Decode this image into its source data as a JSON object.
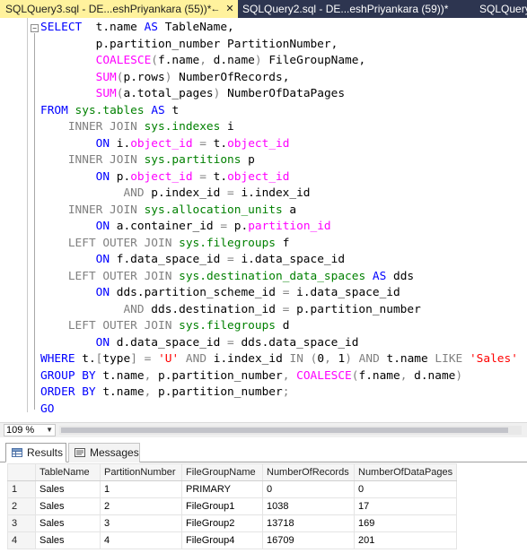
{
  "tabs": [
    {
      "label": "SQLQuery3.sql - DE...eshPriyankara (55))*",
      "pin": "←",
      "close": "✕",
      "active": true
    },
    {
      "label": "SQLQuery2.sql - DE...eshPriyankara (59))*"
    },
    {
      "label": "SQLQuery"
    }
  ],
  "editor": {
    "outline_toggle": "−",
    "lines": [
      [
        [
          "kw",
          "SELECT"
        ],
        [
          "",
          "  t.name "
        ],
        [
          "kw",
          "AS"
        ],
        [
          "",
          " TableName,"
        ]
      ],
      [
        [
          "",
          "        p.partition_number PartitionNumber,"
        ]
      ],
      [
        [
          "",
          "        "
        ],
        [
          "fn",
          "COALESCE"
        ],
        [
          "op",
          "("
        ],
        [
          "",
          "f.name"
        ],
        [
          "op",
          ","
        ],
        [
          "",
          " d.name"
        ],
        [
          "op",
          ")"
        ],
        [
          "",
          " FileGroupName,"
        ]
      ],
      [
        [
          "",
          "        "
        ],
        [
          "fn",
          "SUM"
        ],
        [
          "op",
          "("
        ],
        [
          "",
          "p.rows"
        ],
        [
          "op",
          ")"
        ],
        [
          "",
          " NumberOfRecords,"
        ]
      ],
      [
        [
          "",
          "        "
        ],
        [
          "fn",
          "SUM"
        ],
        [
          "op",
          "("
        ],
        [
          "",
          "a.total_pages"
        ],
        [
          "op",
          ")"
        ],
        [
          "",
          " NumberOfDataPages"
        ]
      ],
      [
        [
          "kw",
          "FROM"
        ],
        [
          "",
          " "
        ],
        [
          "sys",
          "sys.tables"
        ],
        [
          "",
          " "
        ],
        [
          "kw",
          "AS"
        ],
        [
          "",
          " t"
        ]
      ],
      [
        [
          "",
          "    "
        ],
        [
          "op",
          "INNER JOIN"
        ],
        [
          "",
          " "
        ],
        [
          "sys",
          "sys.indexes"
        ],
        [
          "",
          " i"
        ]
      ],
      [
        [
          "",
          "        "
        ],
        [
          "kw",
          "ON"
        ],
        [
          "",
          " i."
        ],
        [
          "fn",
          "object_id"
        ],
        [
          "",
          " "
        ],
        [
          "op",
          "="
        ],
        [
          "",
          " t."
        ],
        [
          "fn",
          "object_id"
        ]
      ],
      [
        [
          "",
          "    "
        ],
        [
          "op",
          "INNER JOIN"
        ],
        [
          "",
          " "
        ],
        [
          "sys",
          "sys.partitions"
        ],
        [
          "",
          " p"
        ]
      ],
      [
        [
          "",
          "        "
        ],
        [
          "kw",
          "ON"
        ],
        [
          "",
          " p."
        ],
        [
          "fn",
          "object_id"
        ],
        [
          "",
          " "
        ],
        [
          "op",
          "="
        ],
        [
          "",
          " t."
        ],
        [
          "fn",
          "object_id"
        ]
      ],
      [
        [
          "",
          "            "
        ],
        [
          "op",
          "AND"
        ],
        [
          "",
          " p.index_id "
        ],
        [
          "op",
          "="
        ],
        [
          "",
          " i.index_id"
        ]
      ],
      [
        [
          "",
          "    "
        ],
        [
          "op",
          "INNER JOIN"
        ],
        [
          "",
          " "
        ],
        [
          "sys",
          "sys.allocation_units"
        ],
        [
          "",
          " a"
        ]
      ],
      [
        [
          "",
          "        "
        ],
        [
          "kw",
          "ON"
        ],
        [
          "",
          " a.container_id "
        ],
        [
          "op",
          "="
        ],
        [
          "",
          " p."
        ],
        [
          "fn",
          "partition_id"
        ]
      ],
      [
        [
          "",
          "    "
        ],
        [
          "op",
          "LEFT OUTER JOIN"
        ],
        [
          "",
          " "
        ],
        [
          "sys",
          "sys.filegroups"
        ],
        [
          "",
          " f"
        ]
      ],
      [
        [
          "",
          "        "
        ],
        [
          "kw",
          "ON"
        ],
        [
          "",
          " f.data_space_id "
        ],
        [
          "op",
          "="
        ],
        [
          "",
          " i.data_space_id"
        ]
      ],
      [
        [
          "",
          "    "
        ],
        [
          "op",
          "LEFT OUTER JOIN"
        ],
        [
          "",
          " "
        ],
        [
          "sys",
          "sys.destination_data_spaces"
        ],
        [
          "",
          " "
        ],
        [
          "kw",
          "AS"
        ],
        [
          "",
          " dds"
        ]
      ],
      [
        [
          "",
          "        "
        ],
        [
          "kw",
          "ON"
        ],
        [
          "",
          " dds.partition_scheme_id "
        ],
        [
          "op",
          "="
        ],
        [
          "",
          " i.data_space_id"
        ]
      ],
      [
        [
          "",
          "            "
        ],
        [
          "op",
          "AND"
        ],
        [
          "",
          " dds.destination_id "
        ],
        [
          "op",
          "="
        ],
        [
          "",
          " p.partition_number"
        ]
      ],
      [
        [
          "",
          "    "
        ],
        [
          "op",
          "LEFT OUTER JOIN"
        ],
        [
          "",
          " "
        ],
        [
          "sys",
          "sys.filegroups"
        ],
        [
          "",
          " d"
        ]
      ],
      [
        [
          "",
          "        "
        ],
        [
          "kw",
          "ON"
        ],
        [
          "",
          " d.data_space_id "
        ],
        [
          "op",
          "="
        ],
        [
          "",
          " dds.data_space_id"
        ]
      ],
      [
        [
          "kw",
          "WHERE"
        ],
        [
          "",
          " t."
        ],
        [
          "op",
          "["
        ],
        [
          "",
          "type"
        ],
        [
          "op",
          "]"
        ],
        [
          "",
          " "
        ],
        [
          "op",
          "="
        ],
        [
          "",
          " "
        ],
        [
          "str",
          "'U'"
        ],
        [
          "",
          " "
        ],
        [
          "op",
          "AND"
        ],
        [
          "",
          " i.index_id "
        ],
        [
          "op",
          "IN"
        ],
        [
          "",
          " "
        ],
        [
          "op",
          "("
        ],
        [
          "",
          "0"
        ],
        [
          "op",
          ","
        ],
        [
          "",
          " 1"
        ],
        [
          "op",
          ")"
        ],
        [
          "",
          " "
        ],
        [
          "op",
          "AND"
        ],
        [
          "",
          " t.name "
        ],
        [
          "op",
          "LIKE"
        ],
        [
          "",
          " "
        ],
        [
          "str",
          "'Sales'"
        ]
      ],
      [
        [
          "kw",
          "GROUP BY"
        ],
        [
          "",
          " t.name"
        ],
        [
          "op",
          ","
        ],
        [
          "",
          " p.partition_number"
        ],
        [
          "op",
          ","
        ],
        [
          "",
          " "
        ],
        [
          "fn",
          "COALESCE"
        ],
        [
          "op",
          "("
        ],
        [
          "",
          "f.name"
        ],
        [
          "op",
          ","
        ],
        [
          "",
          " d.name"
        ],
        [
          "op",
          ")"
        ]
      ],
      [
        [
          "kw",
          "ORDER BY"
        ],
        [
          "",
          " t.name"
        ],
        [
          "op",
          ","
        ],
        [
          "",
          " p.partition_number"
        ],
        [
          "op",
          ";"
        ]
      ],
      [
        [
          "kw",
          "GO"
        ]
      ]
    ]
  },
  "zoom": {
    "value": "109 %",
    "arrow": "▼"
  },
  "result_tabs": [
    {
      "label": "Results",
      "selected": true
    },
    {
      "label": "Messages",
      "selected": false
    }
  ],
  "results": {
    "columns": [
      "TableName",
      "PartitionNumber",
      "FileGroupName",
      "NumberOfRecords",
      "NumberOfDataPages"
    ],
    "rows": [
      {
        "num": "1",
        "cells": [
          "Sales",
          "1",
          "PRIMARY",
          "0",
          "0"
        ]
      },
      {
        "num": "2",
        "cells": [
          "Sales",
          "2",
          "FileGroup1",
          "1038",
          "17"
        ]
      },
      {
        "num": "3",
        "cells": [
          "Sales",
          "3",
          "FileGroup2",
          "13718",
          "169"
        ]
      },
      {
        "num": "4",
        "cells": [
          "Sales",
          "4",
          "FileGroup4",
          "16709",
          "201"
        ]
      }
    ]
  },
  "colors": {
    "tab_active": "#fff29d",
    "tabstrip": "#2d3550",
    "keyword": "#0000ff",
    "function": "#ff00ff",
    "system_object": "#008000",
    "operator": "#808080",
    "string": "#ff0000"
  }
}
